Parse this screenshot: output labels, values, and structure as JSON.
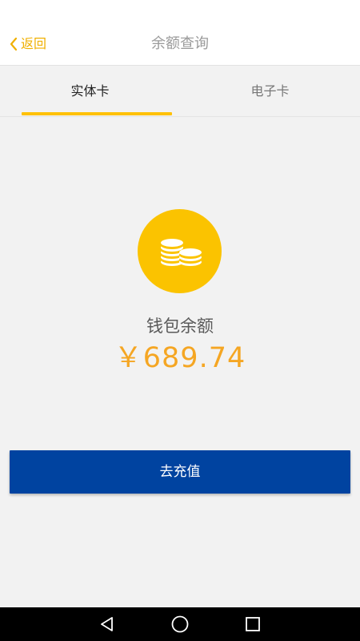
{
  "header": {
    "back_label": "返回",
    "title": "余额查询"
  },
  "tabs": [
    {
      "label": "实体卡",
      "active": true
    },
    {
      "label": "电子卡",
      "active": false
    }
  ],
  "wallet": {
    "icon": "coins-icon",
    "label": "钱包余额",
    "amount": "￥689.74"
  },
  "actions": {
    "recharge_label": "去充值"
  },
  "system_nav": {
    "icons": [
      "back-triangle-icon",
      "home-circle-icon",
      "recent-square-icon"
    ]
  },
  "colors": {
    "accent_yellow": "#ffc107",
    "coin_yellow": "#fbc300",
    "amount_orange": "#f5a623",
    "button_blue": "#0043a0",
    "back_yellow": "#f0b000"
  }
}
